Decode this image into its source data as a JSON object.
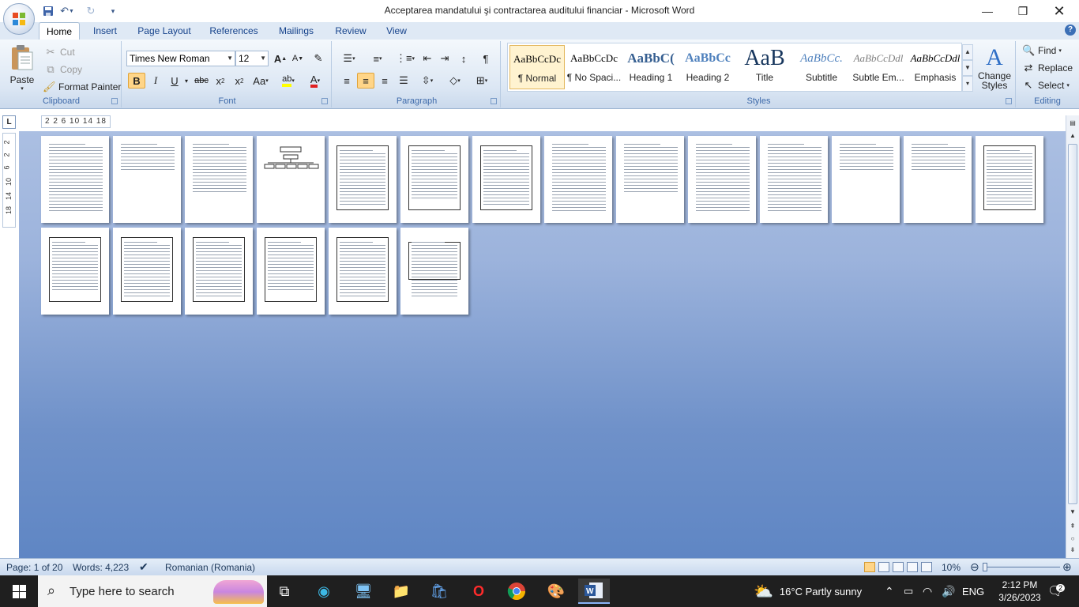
{
  "window": {
    "title": "Acceptarea mandatului şi contractarea auditului financiar - Microsoft Word",
    "controls": [
      "minimize",
      "restore",
      "close"
    ]
  },
  "qat": {
    "icons": [
      "save-icon",
      "undo-icon",
      "redo-icon",
      "customize-icon"
    ]
  },
  "tabs": [
    {
      "label": "Home",
      "active": true
    },
    {
      "label": "Insert"
    },
    {
      "label": "Page Layout"
    },
    {
      "label": "References"
    },
    {
      "label": "Mailings"
    },
    {
      "label": "Review"
    },
    {
      "label": "View"
    }
  ],
  "clipboard": {
    "label": "Clipboard",
    "paste": "Paste",
    "cut": "Cut",
    "copy": "Copy",
    "format_painter": "Format Painter"
  },
  "font": {
    "label": "Font",
    "name": "Times New Roman",
    "size": "12",
    "bold_active": true,
    "highlight_color": "#ffff00",
    "font_color": "#e02020"
  },
  "paragraph": {
    "label": "Paragraph",
    "alignment": "center"
  },
  "styles": {
    "label": "Styles",
    "items": [
      {
        "preview": "AaBbCcDc",
        "name": "¶ Normal"
      },
      {
        "preview": "AaBbCcDc",
        "name": "¶ No Spaci..."
      },
      {
        "preview": "AaBbC(",
        "name": "Heading 1"
      },
      {
        "preview": "AaBbCc",
        "name": "Heading 2"
      },
      {
        "preview": "AaB",
        "name": "Title"
      },
      {
        "preview": "AaBbCc.",
        "name": "Subtitle"
      },
      {
        "preview": "AaBbCcDdl",
        "name": "Subtle Em..."
      },
      {
        "preview": "AaBbCcDdl",
        "name": "Emphasis"
      }
    ],
    "change_styles": "Change Styles"
  },
  "editing": {
    "label": "Editing",
    "find": "Find",
    "replace": "Replace",
    "select": "Select"
  },
  "ruler": {
    "tab_marker": "L",
    "horizontal": "2  2  6  10  14  18",
    "vertical": [
      "2",
      "2",
      "6",
      "10",
      "14",
      "18"
    ]
  },
  "document": {
    "page_count": 20,
    "rows": [
      14,
      6
    ]
  },
  "status": {
    "page": "Page: 1 of 20",
    "words": "Words: 4,223",
    "language": "Romanian (Romania)",
    "zoom": "10%",
    "zoom_value": 0.1
  },
  "taskbar": {
    "search_placeholder": "Type here to search",
    "weather": "16°C  Partly sunny",
    "language": "ENG",
    "time": "2:12 PM",
    "date": "3/26/2023",
    "notifications": "2",
    "apps": [
      "task-view-icon",
      "edge-icon",
      "computer-icon",
      "file-explorer-icon",
      "store-icon",
      "opera-icon",
      "chrome-icon",
      "paint-icon",
      "word-icon"
    ]
  }
}
